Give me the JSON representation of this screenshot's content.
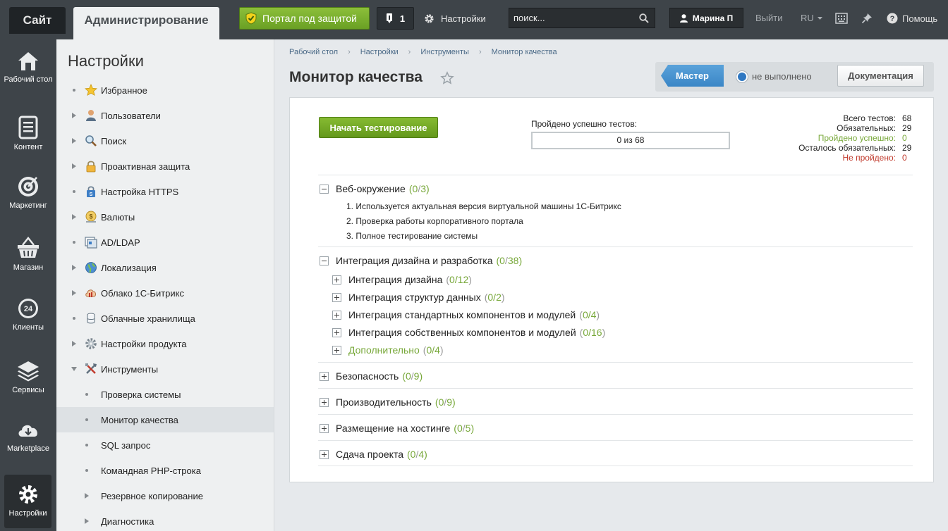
{
  "topbar": {
    "tab_site": "Сайт",
    "tab_admin": "Администрирование",
    "secure_label": "Портал под защитой",
    "notify_count": "1",
    "settings_label": "Настройки",
    "search_placeholder": "поиск...",
    "user_name": "Марина П",
    "logout": "Выйти",
    "lang": "RU",
    "help": "Помощь"
  },
  "iconbar": {
    "items": [
      {
        "label": "Рабочий стол"
      },
      {
        "label": "Контент"
      },
      {
        "label": "Маркетинг"
      },
      {
        "label": "Магазин"
      },
      {
        "label": "Клиенты"
      },
      {
        "label": "Сервисы"
      },
      {
        "label": "Marketplace"
      },
      {
        "label": "Настройки"
      }
    ]
  },
  "menu": {
    "title": "Настройки",
    "items": [
      {
        "label": "Избранное"
      },
      {
        "label": "Пользователи"
      },
      {
        "label": "Поиск"
      },
      {
        "label": "Проактивная защита"
      },
      {
        "label": "Настройка HTTPS"
      },
      {
        "label": "Валюты"
      },
      {
        "label": "AD/LDAP"
      },
      {
        "label": "Локализация"
      },
      {
        "label": "Облако 1С-Битрикс"
      },
      {
        "label": "Облачные хранилища"
      },
      {
        "label": "Настройки продукта"
      },
      {
        "label": "Инструменты"
      }
    ],
    "subitems": [
      {
        "label": "Проверка системы"
      },
      {
        "label": "Монитор качества"
      },
      {
        "label": "SQL запрос"
      },
      {
        "label": "Командная PHP-строка"
      },
      {
        "label": "Резервное копирование"
      },
      {
        "label": "Диагностика"
      }
    ]
  },
  "breadcrumbs": [
    "Рабочий стол",
    "Настройки",
    "Инструменты",
    "Монитор качества"
  ],
  "page_title": "Монитор качества",
  "wizard": {
    "master_label": "Мастер",
    "status_text": "не выполнено",
    "docs_label": "Документация"
  },
  "test": {
    "start_label": "Начать тестирование",
    "passed_label": "Пройдено успешно тестов:",
    "progress_text": "0 из 68",
    "progress_fraction": 0,
    "stats": [
      {
        "key": "Всего тестов:",
        "value": "68"
      },
      {
        "key": "Обязательных:",
        "value": "29"
      },
      {
        "key": "Пройдено успешно:",
        "value": "0"
      },
      {
        "key": "Осталось обязательных:",
        "value": "29"
      },
      {
        "key": "Не пройдено:",
        "value": "0"
      }
    ]
  },
  "sections": [
    {
      "title": "Веб-окружение",
      "done": "0",
      "total": "3"
    },
    {
      "title": "Интеграция дизайна и разработка",
      "done": "0",
      "total": "38"
    },
    {
      "title": "Безопасность",
      "done": "0",
      "total": "9"
    },
    {
      "title": "Производительность",
      "done": "0",
      "total": "9"
    },
    {
      "title": "Размещение на хостинге",
      "done": "0",
      "total": "5"
    },
    {
      "title": "Сдача проекта",
      "done": "0",
      "total": "4"
    }
  ],
  "web_items": [
    "1. Используется актуальная версия виртуальной машины 1С-Битрикс",
    "2. Проверка работы корпоративного портала",
    "3. Полное тестирование системы"
  ],
  "integration_subs": [
    {
      "title": "Интеграция дизайна",
      "count": "0/12"
    },
    {
      "title": "Интеграция структур данных",
      "count": "0/2"
    },
    {
      "title": "Интеграция стандартных компонентов и модулей",
      "count": "0/4"
    },
    {
      "title": "Интеграция собственных компонентов и модулей",
      "count": "0/16"
    },
    {
      "title": "Дополнительно",
      "count": "0/4"
    }
  ],
  "colors": {
    "topbar": "#3e4449",
    "accent_green": "#78a83a",
    "accent_blue": "#3a86c6",
    "error_red": "#c0392b"
  }
}
